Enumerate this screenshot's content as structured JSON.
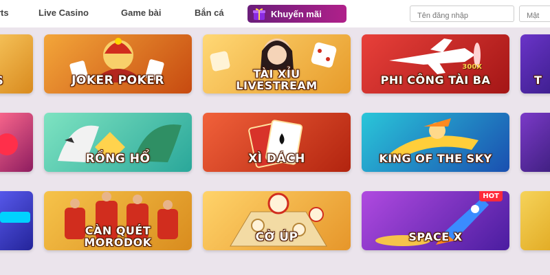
{
  "nav": {
    "items": [
      "rts",
      "Live Casino",
      "Game bài",
      "Bắn cá"
    ],
    "promo_label": "Khuyến mãi",
    "login_placeholder": "Tên đăng nhập",
    "password_placeholder": "Mật"
  },
  "games": [
    {
      "title": "S"
    },
    {
      "title": "JOKER POKER"
    },
    {
      "title_line1": "TÀI XỈU",
      "title_line2": "LIVESTREAM"
    },
    {
      "title": "PHI CÔNG TÀI BA",
      "multiplier": "300X"
    },
    {
      "title": "T"
    },
    {
      "title": ""
    },
    {
      "title": "RỒNG HỔ"
    },
    {
      "title": "XÌ DÁCH"
    },
    {
      "title": "KING OF THE SKY"
    },
    {
      "title": ""
    },
    {
      "title": ""
    },
    {
      "title_line1": "CÀN QUÉT",
      "title_line2": "MORODOK"
    },
    {
      "title": "CỜ ÚP"
    },
    {
      "title": "SPACE X",
      "badge": "HOT"
    },
    {
      "title": ""
    }
  ]
}
